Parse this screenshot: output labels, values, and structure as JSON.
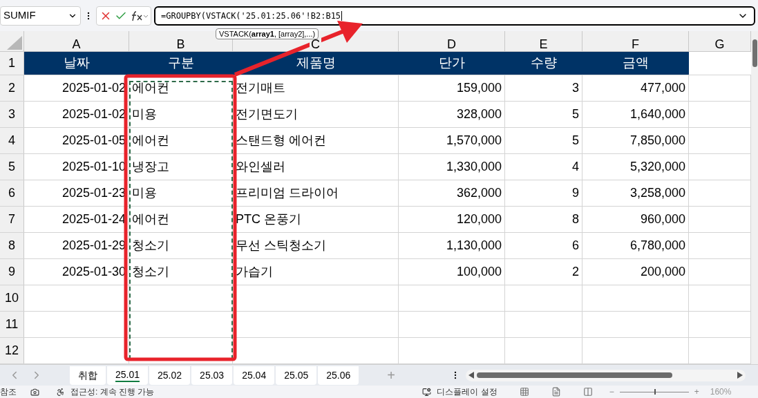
{
  "name_box": "SUMIF",
  "formula": "=GROUPBY(VSTACK('25.01:25.06'!B2:B15",
  "tooltip": "VSTACK(**array1**, [array2],...)",
  "columns": [
    "A",
    "B",
    "C",
    "D",
    "E",
    "F",
    "G"
  ],
  "header_row": {
    "number": "1",
    "cells": [
      "날짜",
      "구분",
      "제품명",
      "단가",
      "수량",
      "금액"
    ]
  },
  "rows": [
    {
      "number": "2",
      "cells": [
        "2025-01-02",
        "에어컨",
        "전기매트",
        "159,000",
        "3",
        "477,000"
      ]
    },
    {
      "number": "3",
      "cells": [
        "2025-01-02",
        "미용",
        "전기면도기",
        "328,000",
        "5",
        "1,640,000"
      ]
    },
    {
      "number": "4",
      "cells": [
        "2025-01-05",
        "에어컨",
        "스탠드형 에어컨",
        "1,570,000",
        "5",
        "7,850,000"
      ]
    },
    {
      "number": "5",
      "cells": [
        "2025-01-10",
        "냉장고",
        "와인셀러",
        "1,330,000",
        "4",
        "5,320,000"
      ]
    },
    {
      "number": "6",
      "cells": [
        "2025-01-23",
        "미용",
        "프리미엄 드라이어",
        "362,000",
        "9",
        "3,258,000"
      ]
    },
    {
      "number": "7",
      "cells": [
        "2025-01-24",
        "에어컨",
        "PTC 온풍기",
        "120,000",
        "8",
        "960,000"
      ]
    },
    {
      "number": "8",
      "cells": [
        "2025-01-29",
        "청소기",
        "무선 스틱청소기",
        "1,130,000",
        "6",
        "6,780,000"
      ]
    },
    {
      "number": "9",
      "cells": [
        "2025-01-30",
        "청소기",
        "가습기",
        "100,000",
        "2",
        "200,000"
      ]
    },
    {
      "number": "10",
      "cells": []
    },
    {
      "number": "11",
      "cells": []
    },
    {
      "number": "12",
      "cells": []
    }
  ],
  "sheet_tabs": [
    {
      "label": "취합",
      "selected": false
    },
    {
      "label": "25.01",
      "selected": true
    },
    {
      "label": "25.02",
      "selected": false
    },
    {
      "label": "25.03",
      "selected": false
    },
    {
      "label": "25.04",
      "selected": false
    },
    {
      "label": "25.05",
      "selected": false
    },
    {
      "label": "25.06",
      "selected": false
    }
  ],
  "add_sheet": "+",
  "status_bar": {
    "left": "참조",
    "accessibility": "접근성: 계속 진행 가능",
    "display": "디스플레이 설정",
    "zoom_minus": "−",
    "zoom_plus": "+",
    "zoom": {
      "label": "160%",
      "level": 0.5
    }
  }
}
